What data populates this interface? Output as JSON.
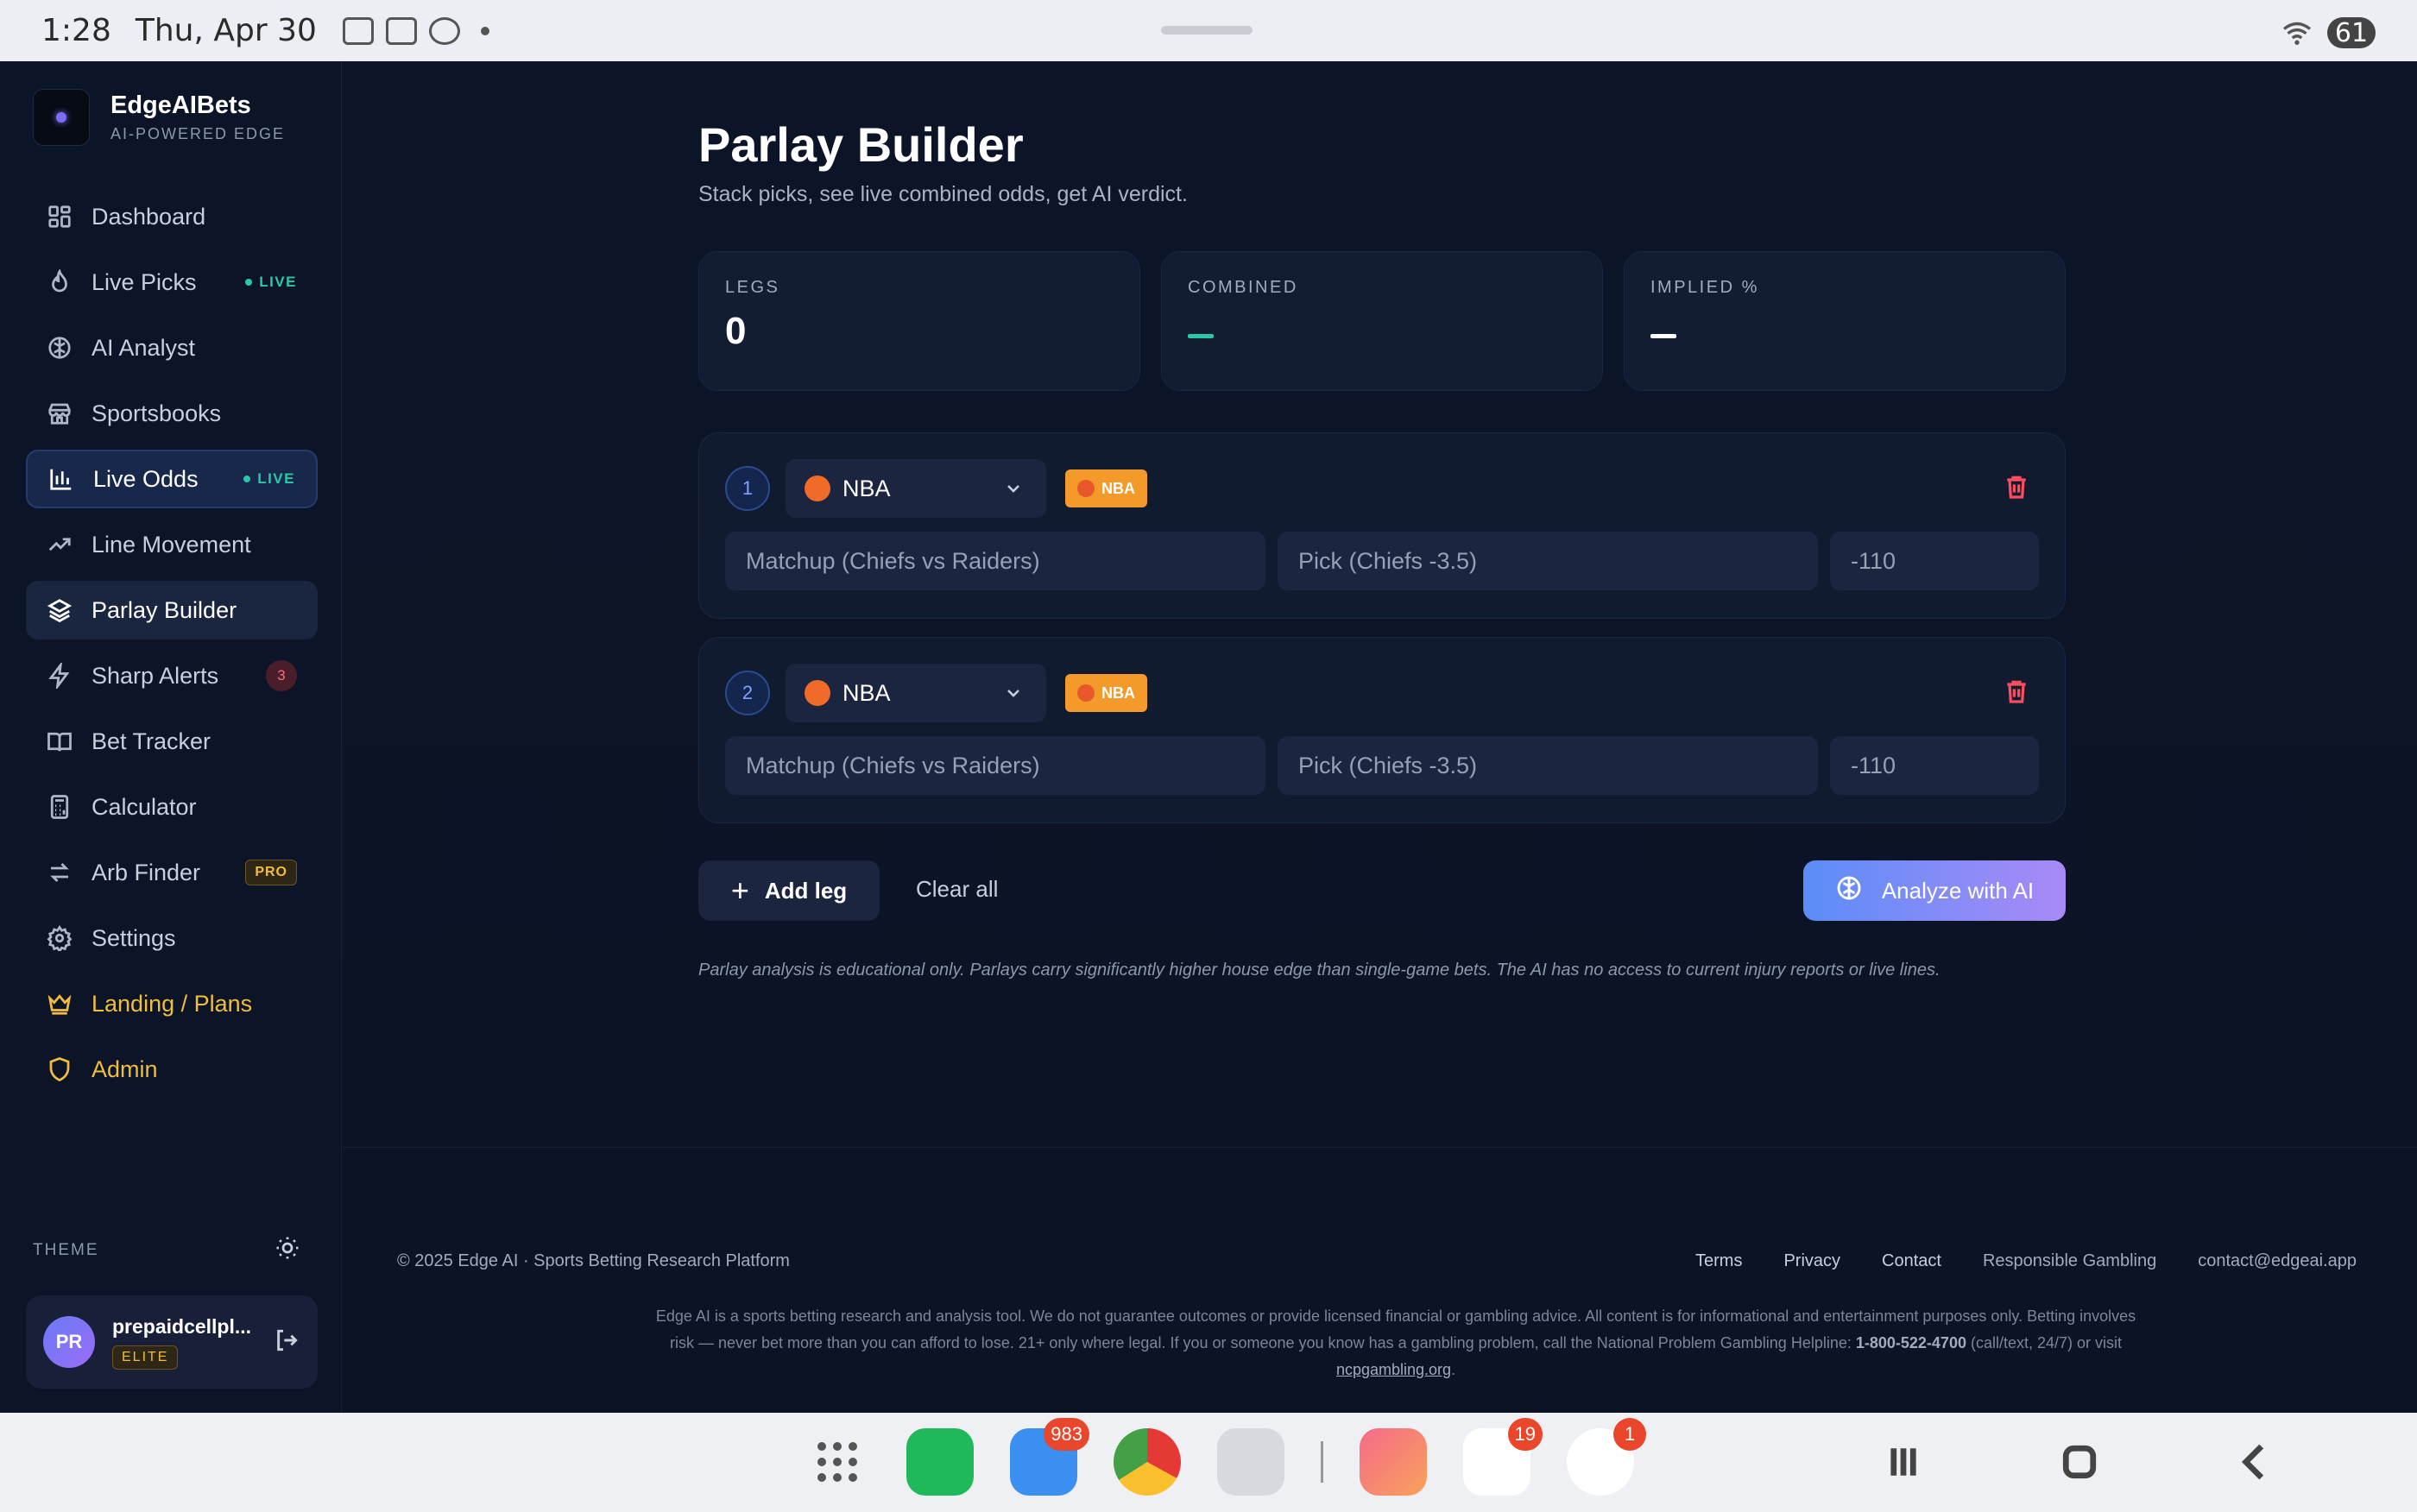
{
  "status_bar": {
    "time": "1:28",
    "date": "Thu, Apr 30",
    "battery": "61"
  },
  "brand": {
    "name": "EdgeAIBets",
    "tagline": "AI-POWERED EDGE"
  },
  "sidebar": {
    "items": [
      {
        "label": "Dashboard",
        "icon": "dashboard-icon"
      },
      {
        "label": "Live Picks",
        "icon": "flame-icon",
        "badge": "LIVE"
      },
      {
        "label": "AI Analyst",
        "icon": "brain-icon"
      },
      {
        "label": "Sportsbooks",
        "icon": "store-icon"
      },
      {
        "label": "Live Odds",
        "icon": "bar-chart-icon",
        "badge": "LIVE",
        "active": true
      },
      {
        "label": "Line Movement",
        "icon": "trend-icon"
      },
      {
        "label": "Parlay Builder",
        "icon": "layers-icon",
        "selected": true
      },
      {
        "label": "Sharp Alerts",
        "icon": "zap-icon",
        "count": "3"
      },
      {
        "label": "Bet Tracker",
        "icon": "book-icon"
      },
      {
        "label": "Calculator",
        "icon": "calculator-icon"
      },
      {
        "label": "Arb Finder",
        "icon": "arrows-icon",
        "badge": "PRO"
      },
      {
        "label": "Settings",
        "icon": "gear-icon"
      },
      {
        "label": "Landing / Plans",
        "icon": "crown-icon"
      },
      {
        "label": "Admin",
        "icon": "shield-icon"
      }
    ],
    "theme_label": "THEME",
    "user": {
      "initials": "PR",
      "name": "prepaidcellpl...",
      "plan": "ELITE"
    }
  },
  "main": {
    "title": "Parlay Builder",
    "subtitle": "Stack picks, see live combined odds, get AI verdict.",
    "stats": [
      {
        "label": "LEGS",
        "value": "0"
      },
      {
        "label": "COMBINED",
        "value": ""
      },
      {
        "label": "IMPLIED %",
        "value": ""
      }
    ],
    "legs": [
      {
        "number": "1",
        "sport": "NBA",
        "tag": "NBA",
        "matchup_placeholder": "Matchup (Chiefs vs Raiders)",
        "pick_placeholder": "Pick (Chiefs -3.5)",
        "odds_placeholder": "-110"
      },
      {
        "number": "2",
        "sport": "NBA",
        "tag": "NBA",
        "matchup_placeholder": "Matchup (Chiefs vs Raiders)",
        "pick_placeholder": "Pick (Chiefs -3.5)",
        "odds_placeholder": "-110"
      }
    ],
    "add_leg": "Add leg",
    "clear_all": "Clear all",
    "analyze": "Analyze with AI",
    "disclaimer": "Parlay analysis is educational only. Parlays carry significantly higher house edge than single-game bets. The AI has no access to current injury reports or live lines."
  },
  "footer": {
    "copyright": "© 2025 Edge AI · Sports Betting Research Platform",
    "links": [
      "Terms",
      "Privacy",
      "Contact",
      "Responsible Gambling",
      "contact@edgeai.app"
    ],
    "legal_1": "Edge AI is a sports betting research and analysis tool. We do not guarantee outcomes or provide licensed financial or gambling advice. All content is for informational and entertainment purposes only. Betting involves risk — never bet more than you can afford to lose. 21+ only where legal. If you or someone you know has a gambling problem, call the National Problem Gambling Helpline: ",
    "helpline": "1-800-522-4700",
    "legal_2": " (call/text, 24/7) or visit ",
    "legal_link": "ncpgambling.org",
    "legal_3": "."
  },
  "dock": {
    "apps": [
      {
        "name": "phone-app",
        "color": "#1fb85b"
      },
      {
        "name": "mail-app",
        "color": "#3a8ff0",
        "count": "983"
      },
      {
        "name": "chrome-app",
        "color": "#ffffff"
      },
      {
        "name": "camera-app",
        "color": "#d7d9de"
      },
      {
        "name": "gallery-app",
        "color": "#f56a8a"
      },
      {
        "name": "gmail-app",
        "color": "#ffffff",
        "count": "19"
      },
      {
        "name": "google-app",
        "color": "#ffffff",
        "count": "1"
      }
    ]
  },
  "colors": {
    "accent_teal": "#28c9a6",
    "gold": "#f2bd3a",
    "danger": "#ff4d5e",
    "nba_tag": "#f39a2b",
    "ai_gradient_start": "#5b8df8",
    "ai_gradient_end": "#a98af7"
  }
}
